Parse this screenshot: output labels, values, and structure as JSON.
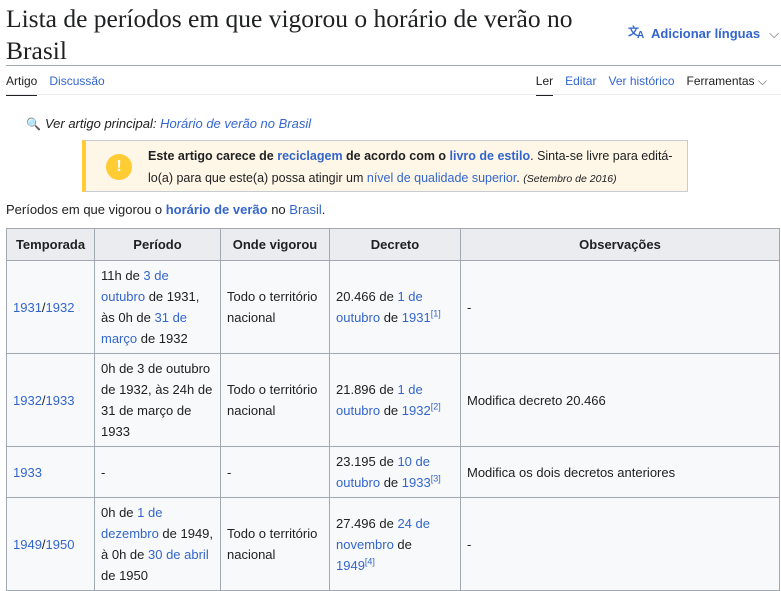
{
  "page": {
    "title": "Lista de períodos em que vigorou o horário de verão no Brasil",
    "languages": "Adicionar línguas"
  },
  "tabs": {
    "article": "Artigo",
    "talk": "Discussão",
    "read": "Ler",
    "edit": "Editar",
    "history": "Ver histórico",
    "tools": "Ferramentas"
  },
  "hatnote": {
    "prefix": "Ver artigo principal: ",
    "link": "Horário de verão no Brasil"
  },
  "ambox": {
    "t1": "Este artigo carece de ",
    "l1": "reciclagem",
    "t2": " de acordo com o ",
    "l2": "livro de estilo",
    "t3": ". Sinta-se livre para editá-lo(a) para que este(a) possa atingir um ",
    "l3": "nível de qualidade superior",
    "t4": ". ",
    "date": "(Setembro de 2016)"
  },
  "intro": {
    "t1": "Períodos em que vigorou o ",
    "l1": "horário de verão",
    "t2": " no ",
    "l2": "Brasil",
    "t3": "."
  },
  "table": {
    "headers": [
      "Temporada",
      "Período",
      "Onde vigorou",
      "Decreto",
      "Observações"
    ],
    "rows": [
      {
        "season_a": "1931",
        "season_sep": "/",
        "season_b": "1932",
        "p1": "11h de ",
        "p2": "3 de outubro",
        "p3": " de 1931, às 0h de ",
        "p4": "31 de março",
        "p5": " de 1932",
        "where": "Todo o território nacional",
        "d1": "20.466 de ",
        "d2": "1 de outubro",
        "d3": " de ",
        "d4": "1931",
        "ref": "[1]",
        "obs": "-"
      },
      {
        "season_a": "1932",
        "season_sep": "/",
        "season_b": "1933",
        "period": "0h de 3 de outubro de 1932, às 24h de 31 de março de 1933",
        "where": "Todo o território nacional",
        "d1": "21.896 de ",
        "d2": "1 de outubro",
        "d3": " de ",
        "d4": "1932",
        "ref": "[2]",
        "obs": "Modifica decreto 20.466"
      },
      {
        "season": "1933",
        "period": "-",
        "where": "-",
        "d1": "23.195 de ",
        "d2": "10 de outubro",
        "d3": " de ",
        "d4": "1933",
        "ref": "[3]",
        "obs": "Modifica os dois decretos anteriores"
      },
      {
        "season_a": "1949",
        "season_sep": "/",
        "season_b": "1950",
        "p1": "0h de ",
        "p2": "1 de dezembro",
        "p3": " de 1949, à 0h de ",
        "p4": "30 de abril",
        "p5": " de 1950",
        "where": "Todo o território nacional",
        "d1": "27.496 de ",
        "d2": "24 de novembro",
        "d3": " de ",
        "d4": "1949",
        "ref": "[4]",
        "obs": "-"
      }
    ]
  }
}
